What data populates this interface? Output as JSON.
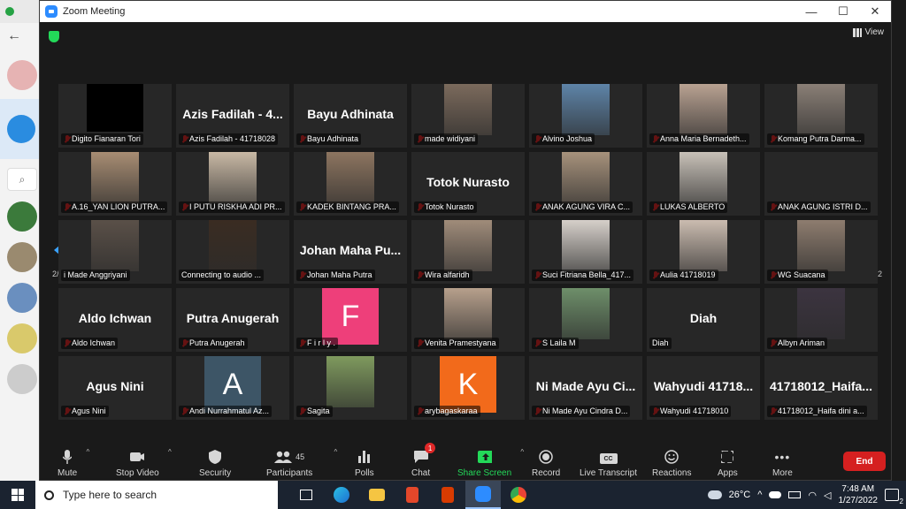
{
  "window": {
    "title": "Zoom Meeting",
    "minimize": "—",
    "maximize": "☐",
    "close": "✕"
  },
  "top_right": {
    "view_label": "View"
  },
  "pagination": {
    "left": "2/2",
    "right": "2/2"
  },
  "participants": [
    {
      "display": "",
      "caption": "Digito Fianaran Tori",
      "muted": true,
      "kind": "black"
    },
    {
      "display": "Azis Fadilah - 4...",
      "caption": "Azis Fadilah - 41718028",
      "muted": true,
      "kind": "name"
    },
    {
      "display": "Bayu Adhinata",
      "caption": "Bayu Adhinata",
      "muted": true,
      "kind": "name"
    },
    {
      "display": "",
      "caption": "made widiyani",
      "muted": true,
      "kind": "photo",
      "color": "#7b6a5c"
    },
    {
      "display": "",
      "caption": "Alvino Joshua",
      "muted": true,
      "kind": "photo",
      "color": "#5e84a8"
    },
    {
      "display": "",
      "caption": "Anna Maria Bernadeth...",
      "muted": true,
      "kind": "photo",
      "color": "#b9a292"
    },
    {
      "display": "",
      "caption": "Komang Putra Darma...",
      "muted": true,
      "kind": "photo",
      "color": "#8a7f76"
    },
    {
      "display": "",
      "caption": "A.16_YAN LION PUTRA...",
      "muted": true,
      "kind": "photo",
      "color": "#a88d73"
    },
    {
      "display": "",
      "caption": "I PUTU RISKHA ADI PR...",
      "muted": true,
      "kind": "photo",
      "color": "#c9b9a5"
    },
    {
      "display": "",
      "caption": "KADEK BINTANG PRA...",
      "muted": true,
      "kind": "photo",
      "color": "#8d7560"
    },
    {
      "display": "Totok Nurasto",
      "caption": "Totok Nurasto",
      "muted": true,
      "kind": "name"
    },
    {
      "display": "",
      "caption": "ANAK AGUNG VIRA C...",
      "muted": true,
      "kind": "photo",
      "color": "#a7927c"
    },
    {
      "display": "",
      "caption": "LUKAS ALBERTO",
      "muted": true,
      "kind": "photo",
      "color": "#c8c1b8"
    },
    {
      "display": "",
      "caption": "ANAK AGUNG ISTRI D...",
      "muted": true,
      "kind": "empty"
    },
    {
      "display": "",
      "caption": "i Made Anggriyani",
      "muted": false,
      "kind": "photo",
      "color": "#5a5048"
    },
    {
      "display": "",
      "caption": "Connecting to audio ...",
      "muted": false,
      "kind": "photo",
      "color": "#3a2c22"
    },
    {
      "display": "Johan Maha Pu...",
      "caption": "Johan Maha Putra",
      "muted": true,
      "kind": "name"
    },
    {
      "display": "",
      "caption": "Wira alfaridh",
      "muted": true,
      "kind": "photo",
      "color": "#a08c7a"
    },
    {
      "display": "",
      "caption": "Suci Fitriana Bella_417...",
      "muted": true,
      "kind": "photo",
      "color": "#d6d0ca"
    },
    {
      "display": "",
      "caption": "Aulia 41718019",
      "muted": true,
      "kind": "photo",
      "color": "#cbbcb0"
    },
    {
      "display": "",
      "caption": "WG Suacana",
      "muted": true,
      "kind": "photo",
      "color": "#8e7d6f"
    },
    {
      "display": "Aldo Ichwan",
      "caption": "Aldo Ichwan",
      "muted": true,
      "kind": "name"
    },
    {
      "display": "Putra Anugerah",
      "caption": "Putra Anugerah",
      "muted": true,
      "kind": "name"
    },
    {
      "display": "F",
      "caption": "F i r l y .",
      "muted": true,
      "kind": "letter",
      "color": "#ee3f7a"
    },
    {
      "display": "",
      "caption": "Venita Pramestyana",
      "muted": true,
      "kind": "photo",
      "color": "#b7a08c"
    },
    {
      "display": "",
      "caption": "S Laila M",
      "muted": true,
      "kind": "photo",
      "color": "#6e8f6a"
    },
    {
      "display": "Diah",
      "caption": "Diah",
      "muted": false,
      "kind": "name"
    },
    {
      "display": "",
      "caption": "Albyn Ariman",
      "muted": true,
      "kind": "photo",
      "color": "#3c3440"
    },
    {
      "display": "Agus Nini",
      "caption": "Agus Nini",
      "muted": true,
      "kind": "name"
    },
    {
      "display": "A",
      "caption": "Andi Nurrahmatul Az...",
      "muted": true,
      "kind": "letter",
      "color": "#3d5566"
    },
    {
      "display": "",
      "caption": "Sagita",
      "muted": true,
      "kind": "photo",
      "color": "#7f9a5e"
    },
    {
      "display": "K",
      "caption": "arybagaskaraa",
      "muted": true,
      "kind": "letter",
      "color": "#f26a1b"
    },
    {
      "display": "Ni Made Ayu Ci...",
      "caption": "Ni Made Ayu Cindra D...",
      "muted": true,
      "kind": "name"
    },
    {
      "display": "Wahyudi 41718...",
      "caption": "Wahyudi 41718010",
      "muted": true,
      "kind": "name"
    },
    {
      "display": "41718012_Haifa...",
      "caption": "41718012_Haifa dini a...",
      "muted": true,
      "kind": "name"
    }
  ],
  "toolbar": {
    "mute": "Mute",
    "stop_video": "Stop Video",
    "security": "Security",
    "participants": "Participants",
    "participants_count": "45",
    "polls": "Polls",
    "chat": "Chat",
    "chat_badge": "1",
    "share_screen": "Share Screen",
    "record": "Record",
    "live_transcript": "Live Transcript",
    "reactions": "Reactions",
    "apps": "Apps",
    "more": "More",
    "end": "End",
    "cc_label": "CC"
  },
  "taskbar": {
    "search_placeholder": "Type here to search",
    "weather": "26°C",
    "time": "7:48 AM",
    "date": "1/27/2022",
    "notif_count": "2"
  },
  "colors": {
    "accent": "#2d8cff",
    "share": "#23d959",
    "end": "#d52020",
    "muted_red": "#e02828"
  }
}
